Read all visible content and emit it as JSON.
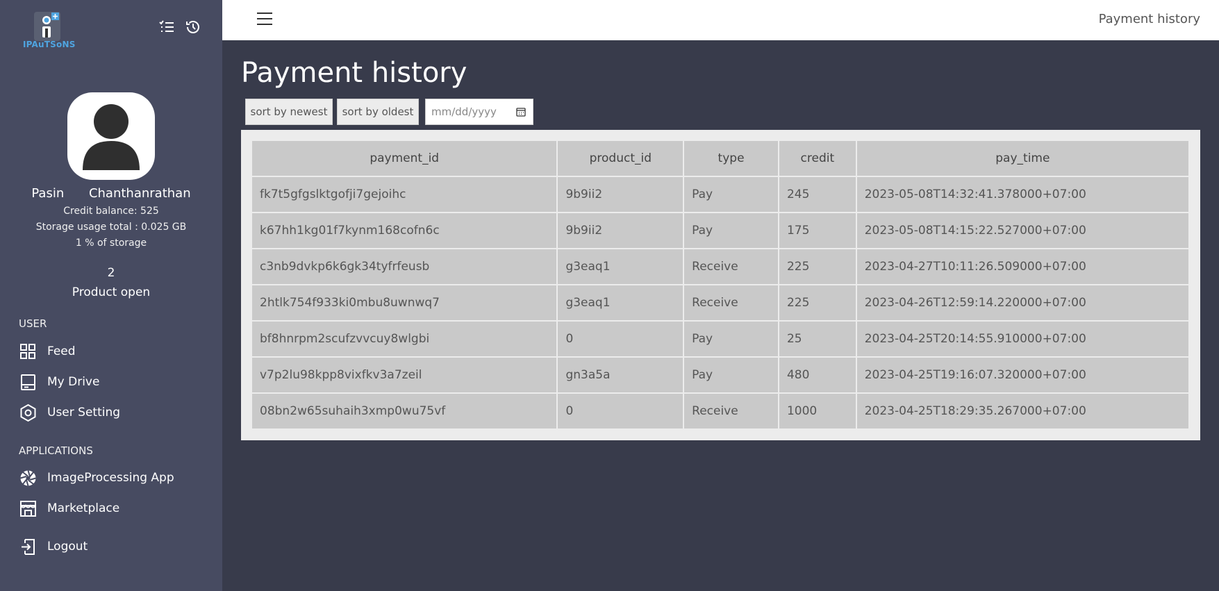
{
  "sidebar": {
    "logo_text": "IPAuTSoNS",
    "user": {
      "name": "Pasin Chanthanrathan",
      "credit_balance": "Credit balance: 525",
      "storage_usage": "Storage usage total : 0.025 GB",
      "storage_percent": "1 % of storage",
      "product_count": "2",
      "product_label": "Product open"
    },
    "sections": {
      "user": "USER",
      "applications": "APPLICATIONS"
    },
    "items": [
      {
        "label": "Feed",
        "icon": "grid-icon"
      },
      {
        "label": "My Drive",
        "icon": "drive-icon"
      },
      {
        "label": "User Setting",
        "icon": "settings-icon"
      },
      {
        "label": "ImageProcessing App",
        "icon": "aperture-icon"
      },
      {
        "label": "Marketplace",
        "icon": "store-icon"
      },
      {
        "label": "Logout",
        "icon": "logout-icon"
      }
    ]
  },
  "topbar": {
    "title": "Payment history"
  },
  "main": {
    "title": "Payment history",
    "sort_newest": "sort by newest",
    "sort_oldest": "sort by oldest",
    "date_placeholder": "mm/dd/yyyy"
  },
  "table": {
    "columns": [
      "payment_id",
      "product_id",
      "type",
      "credit",
      "pay_time"
    ],
    "rows": [
      [
        "fk7t5gfgslktgofji7gejoihc",
        "9b9ii2",
        "Pay",
        "245",
        "2023-05-08T14:32:41.378000+07:00"
      ],
      [
        "k67hh1kg01f7kynm168cofn6c",
        "9b9ii2",
        "Pay",
        "175",
        "2023-05-08T14:15:22.527000+07:00"
      ],
      [
        "c3nb9dvkp6k6gk34tyfrfeusb",
        "g3eaq1",
        "Receive",
        "225",
        "2023-04-27T10:11:26.509000+07:00"
      ],
      [
        "2htlk754f933ki0mbu8uwnwq7",
        "g3eaq1",
        "Receive",
        "225",
        "2023-04-26T12:59:14.220000+07:00"
      ],
      [
        "bf8hnrpm2scufzvvcuy8wlgbi",
        "0",
        "Pay",
        "25",
        "2023-04-25T20:14:55.910000+07:00"
      ],
      [
        "v7p2lu98kpp8vixfkv3a7zeil",
        "gn3a5a",
        "Pay",
        "480",
        "2023-04-25T19:16:07.320000+07:00"
      ],
      [
        "08bn2w65suhaih3xmp0wu75vf",
        "0",
        "Receive",
        "1000",
        "2023-04-25T18:29:35.267000+07:00"
      ]
    ]
  }
}
